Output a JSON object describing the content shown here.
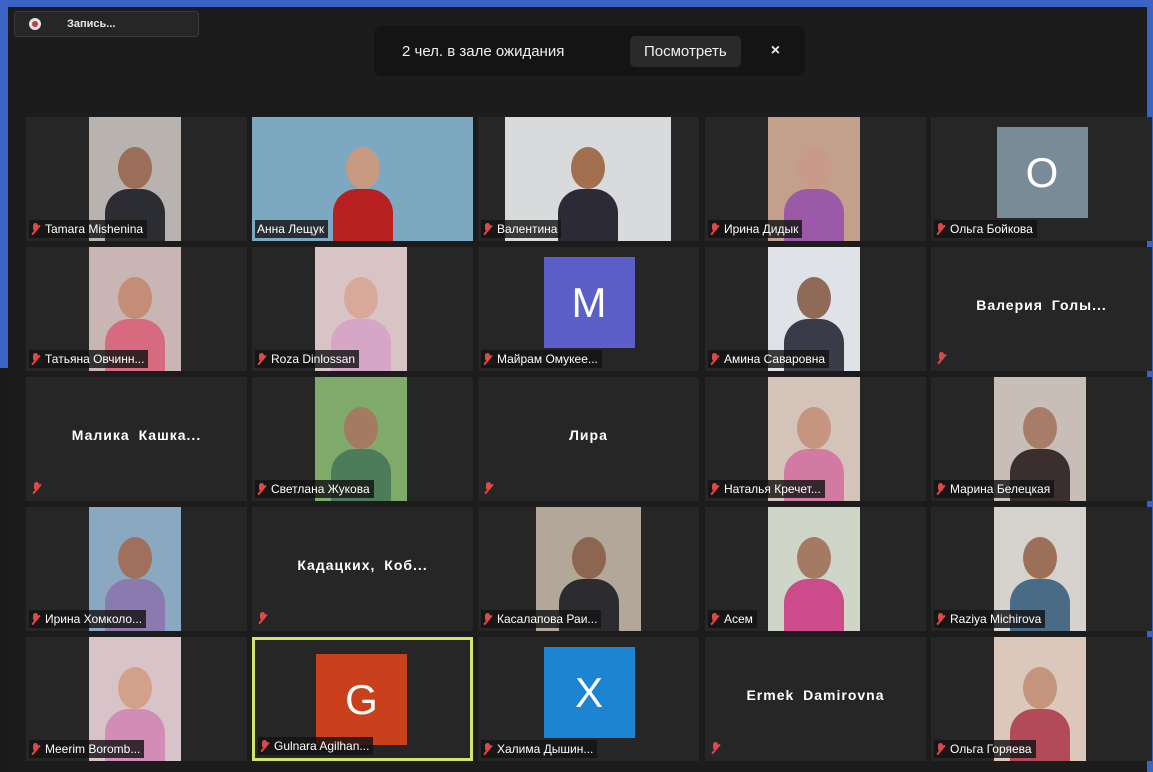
{
  "recording": {
    "label": "Запись..."
  },
  "waiting_room": {
    "text": "2 чел. в зале ожидания",
    "view_label": "Посмотреть",
    "close_glyph": "×"
  },
  "participants": [
    {
      "name": "Tamara Mishenina",
      "kind": "video",
      "muted": true
    },
    {
      "name": "Анна Лещук",
      "kind": "video",
      "muted": false
    },
    {
      "name": "Валентина",
      "kind": "video",
      "muted": true
    },
    {
      "name": "Ирина Дидык",
      "kind": "video",
      "muted": true
    },
    {
      "name": "Ольга Бойкова",
      "kind": "avatar",
      "letter": "O",
      "color": "#788c98",
      "muted": true
    },
    {
      "name": "Татьяна Овчинн...",
      "kind": "video",
      "muted": true
    },
    {
      "name": "Roza Dinlossan",
      "kind": "video",
      "muted": true
    },
    {
      "name": "Майрам Омукее...",
      "kind": "avatar",
      "letter": "M",
      "color": "#5b5fc7",
      "muted": true
    },
    {
      "name": "Амина Саваровна",
      "kind": "video",
      "muted": true
    },
    {
      "name": "Валерия Голы...",
      "kind": "name",
      "muted": true
    },
    {
      "name": "Малика Кашка...",
      "kind": "name",
      "muted": true
    },
    {
      "name": "Светлана Жукова",
      "kind": "video",
      "muted": true
    },
    {
      "name": "Лира",
      "kind": "name",
      "muted": true
    },
    {
      "name": "Наталья Кречет...",
      "kind": "video",
      "muted": true
    },
    {
      "name": "Марина Белецкая",
      "kind": "video",
      "muted": true
    },
    {
      "name": "Ирина Хомколо...",
      "kind": "video",
      "muted": true
    },
    {
      "name": "Кадацких, Коб...",
      "kind": "name",
      "muted": true
    },
    {
      "name": "Касалапова Раи...",
      "kind": "video",
      "muted": true
    },
    {
      "name": "Асем",
      "kind": "video",
      "muted": true
    },
    {
      "name": "Raziya Michirova",
      "kind": "video",
      "muted": true
    },
    {
      "name": "Meerim Boromb...",
      "kind": "video",
      "muted": true
    },
    {
      "name": "Gulnara Agilhan...",
      "kind": "avatar",
      "letter": "G",
      "color": "#c8401c",
      "muted": true,
      "active": true
    },
    {
      "name": "Халима Дышин...",
      "kind": "avatar",
      "letter": "X",
      "color": "#1d84d2",
      "muted": true
    },
    {
      "name": "Ermek Damirovna",
      "kind": "name",
      "muted": true
    },
    {
      "name": "Ольга Горяева",
      "kind": "video",
      "muted": true
    }
  ]
}
